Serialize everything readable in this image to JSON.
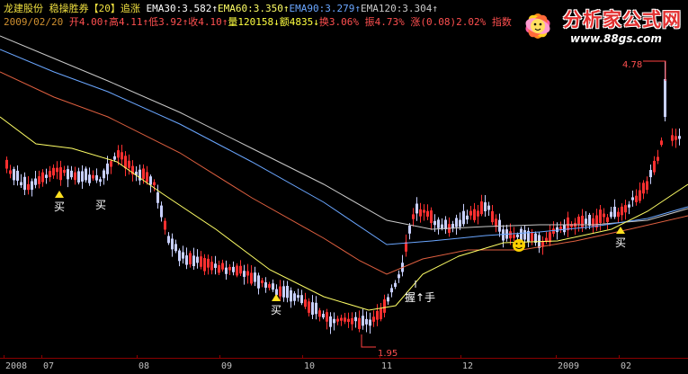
{
  "header": {
    "line1": [
      {
        "text": "龙建股份",
        "color": "#f0e040"
      },
      {
        "text": " 稳操胜券【20】追涨 ",
        "color": "#f0e040"
      },
      {
        "text": "EMA30:3.582↑",
        "color": "#ffffff"
      },
      {
        "text": "EMA60:3.350↑",
        "color": "#ffff66"
      },
      {
        "text": "EMA90:3.279↑",
        "color": "#6aa6ff"
      },
      {
        "text": "EMA120:3.304↑",
        "color": "#c9c9c9"
      }
    ],
    "line2": [
      {
        "text": "2009/02/20 ",
        "color": "#d09030"
      },
      {
        "text": "开4.00↑",
        "color": "#ff5050"
      },
      {
        "text": "高4.11↑",
        "color": "#ff5050"
      },
      {
        "text": "低3.92↑",
        "color": "#ff5050"
      },
      {
        "text": "收4.10↑",
        "color": "#ff5050"
      },
      {
        "text": "量120158↓",
        "color": "#ffff40"
      },
      {
        "text": "额4835↓",
        "color": "#ffff40"
      },
      {
        "text": "换3.06%",
        "color": "#ff5050"
      },
      {
        "text": " 振4.73%",
        "color": "#ff5050"
      },
      {
        "text": " 涨(0.08)2.02%",
        "color": "#ff5050"
      },
      {
        "text": " 指数",
        "color": "#ff5050"
      }
    ]
  },
  "watermark": {
    "title": "分析家公式网",
    "url": "www.88gs.com"
  },
  "annotations": [
    {
      "text": "4.78",
      "kind": "high"
    },
    {
      "text": "1.95",
      "kind": "low"
    },
    {
      "text": "买",
      "kind": "buy"
    },
    {
      "text": "买",
      "kind": "buy"
    },
    {
      "text": "买",
      "kind": "buy"
    },
    {
      "text": "握↑手",
      "kind": "label"
    },
    {
      "text": "买",
      "kind": "buy"
    }
  ],
  "x_axis": {
    "labels": [
      "2008",
      "07",
      "08",
      "09",
      "10",
      "11",
      "12",
      "2009",
      "02"
    ]
  },
  "colors": {
    "up": "#ff3030",
    "down": "#c8d0ff",
    "ema30": "#ffffff",
    "ema60": "#ffff66",
    "ema90": "#e06040",
    "ema120": "#6aa6ff",
    "ema_long": "#c9c9c9"
  },
  "chart_data": {
    "type": "candlestick",
    "ylim": [
      1.9,
      5.0
    ],
    "high_marker": 4.78,
    "low_marker": 1.95
  }
}
